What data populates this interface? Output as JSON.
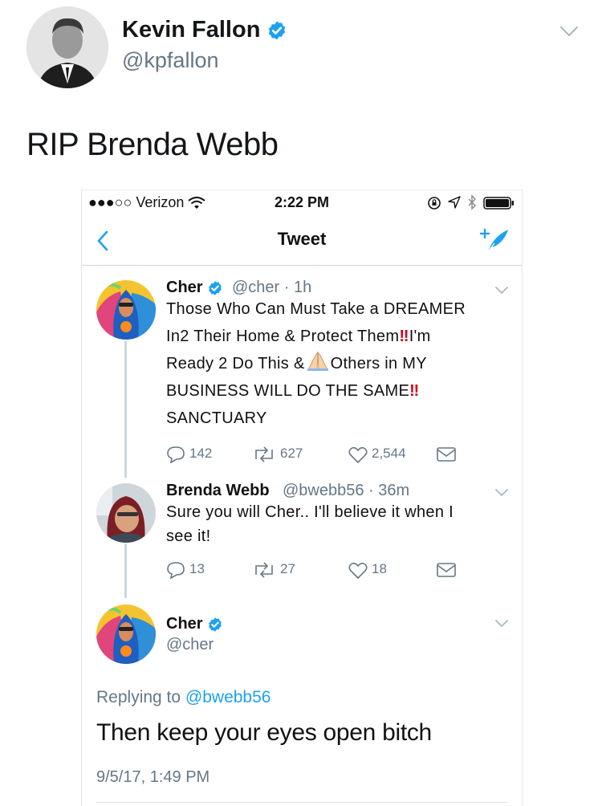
{
  "outer_tweet": {
    "name": "Kevin Fallon",
    "handle": "@kpfallon",
    "text": "RIP Brenda Webb"
  },
  "status_bar": {
    "carrier": "●●●○○ Verizon",
    "time": "2:22 PM"
  },
  "nav": {
    "title": "Tweet"
  },
  "tweets": [
    {
      "name": "Cher",
      "handle_time": "@cher · 1h",
      "lines": [
        "Those Who Can Must Take a DREAMER",
        "In2 Their Home & Protect Them",
        "I'm",
        "Ready 2 Do This &",
        "Others in MY",
        "BUSINESS WILL DO THE SAME",
        "SANCTUARY"
      ],
      "replies": "142",
      "retweets": "627",
      "likes": "2,544"
    },
    {
      "name": "Brenda Webb",
      "handle_time": "@bwebb56 · 36m",
      "lines": [
        "Sure you will Cher.. I'll believe it when I",
        "see it!"
      ],
      "replies": "13",
      "retweets": "27",
      "likes": "18"
    }
  ],
  "main_tweet": {
    "name": "Cher",
    "handle": "@cher",
    "replying_prefix": "Replying to",
    "replying_to": "@bwebb56",
    "text": "Then keep your eyes open bitch",
    "date": "9/5/17, 1:49 PM"
  },
  "colors": {
    "twitter_blue": "#1da1f2",
    "gray_text": "#657786",
    "red_exclaim": "#d0021b"
  }
}
